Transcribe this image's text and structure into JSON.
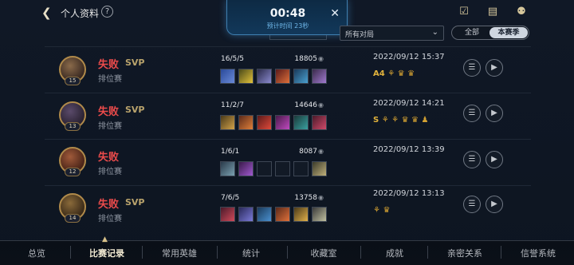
{
  "header": {
    "back_icon": "chevron-left-icon",
    "title": "个人资料",
    "help_label": "?",
    "icons": [
      "checklist-icon",
      "chat-icon",
      "friends-icon"
    ]
  },
  "timer_popup": {
    "time": "00:48",
    "label": "预计时间 23秒",
    "close": "✕"
  },
  "filters": {
    "match_type": "所有对局",
    "segments": [
      "全部",
      "本赛季"
    ],
    "active_segment": "本赛季"
  },
  "matches": [
    {
      "level": "15",
      "result": "失败",
      "badge": "SVP",
      "mode": "排位赛",
      "kda": "16/5/5",
      "score": "18805",
      "date": "2022/09/12 15:37",
      "honors": "A4"
    },
    {
      "level": "13",
      "result": "失败",
      "badge": "SVP",
      "mode": "排位赛",
      "kda": "11/2/7",
      "score": "14646",
      "date": "2022/09/12 14:21",
      "honors": "S"
    },
    {
      "level": "12",
      "result": "失败",
      "badge": "",
      "mode": "排位赛",
      "kda": "1/6/1",
      "score": "8087",
      "date": "2022/09/12 13:39",
      "honors": ""
    },
    {
      "level": "14",
      "result": "失败",
      "badge": "SVP",
      "mode": "排位赛",
      "kda": "7/6/5",
      "score": "13758",
      "date": "2022/09/12 13:13",
      "honors": ""
    }
  ],
  "row_buttons": [
    "list-icon",
    "replay-icon"
  ],
  "bottom_nav": [
    "总览",
    "比赛记录",
    "常用英雄",
    "统计",
    "收藏室",
    "成就",
    "亲密关系",
    "信誉系统"
  ],
  "bottom_nav_active": "比赛记录",
  "colors": {
    "defeat": "#ea4b4b",
    "svp": "#b9a36c",
    "accent": "#d9c28a"
  }
}
